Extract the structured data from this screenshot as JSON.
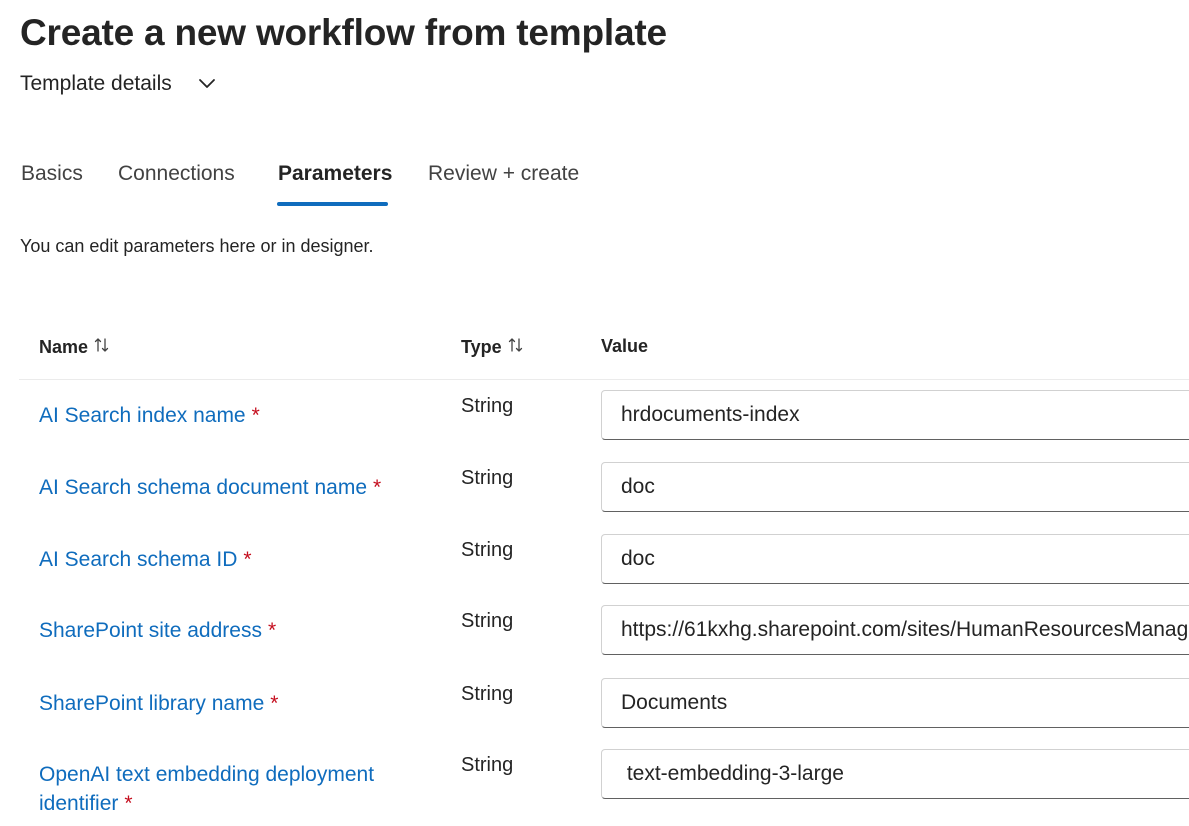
{
  "page": {
    "title": "Create a new workflow from template",
    "template_details_label": "Template details"
  },
  "tabs": [
    {
      "label": "Basics",
      "active": false
    },
    {
      "label": "Connections",
      "active": false
    },
    {
      "label": "Parameters",
      "active": true
    },
    {
      "label": "Review + create",
      "active": false
    }
  ],
  "description": "You can edit parameters here or in designer.",
  "table": {
    "columns": {
      "name": "Name",
      "type": "Type",
      "value": "Value"
    },
    "required_marker": "*",
    "rows": [
      {
        "name": "AI Search index name",
        "type": "String",
        "value": "hrdocuments-index"
      },
      {
        "name": "AI Search schema document name",
        "type": "String",
        "value": "doc"
      },
      {
        "name": "AI Search schema ID",
        "type": "String",
        "value": "doc"
      },
      {
        "name": "SharePoint site address",
        "type": "String",
        "value": "https://61kxhg.sharepoint.com/sites/HumanResourcesManag"
      },
      {
        "name": "SharePoint library name",
        "type": "String",
        "value": "Documents"
      },
      {
        "name": "OpenAI text embedding deployment identifier",
        "type": "String",
        "value": " text-embedding-3-large"
      }
    ]
  },
  "colors": {
    "accent": "#0f6cbd",
    "required": "#c50f1f"
  },
  "icons": {
    "details_toggle": "chevron-down-icon",
    "sort": "sort-arrows-icon"
  }
}
